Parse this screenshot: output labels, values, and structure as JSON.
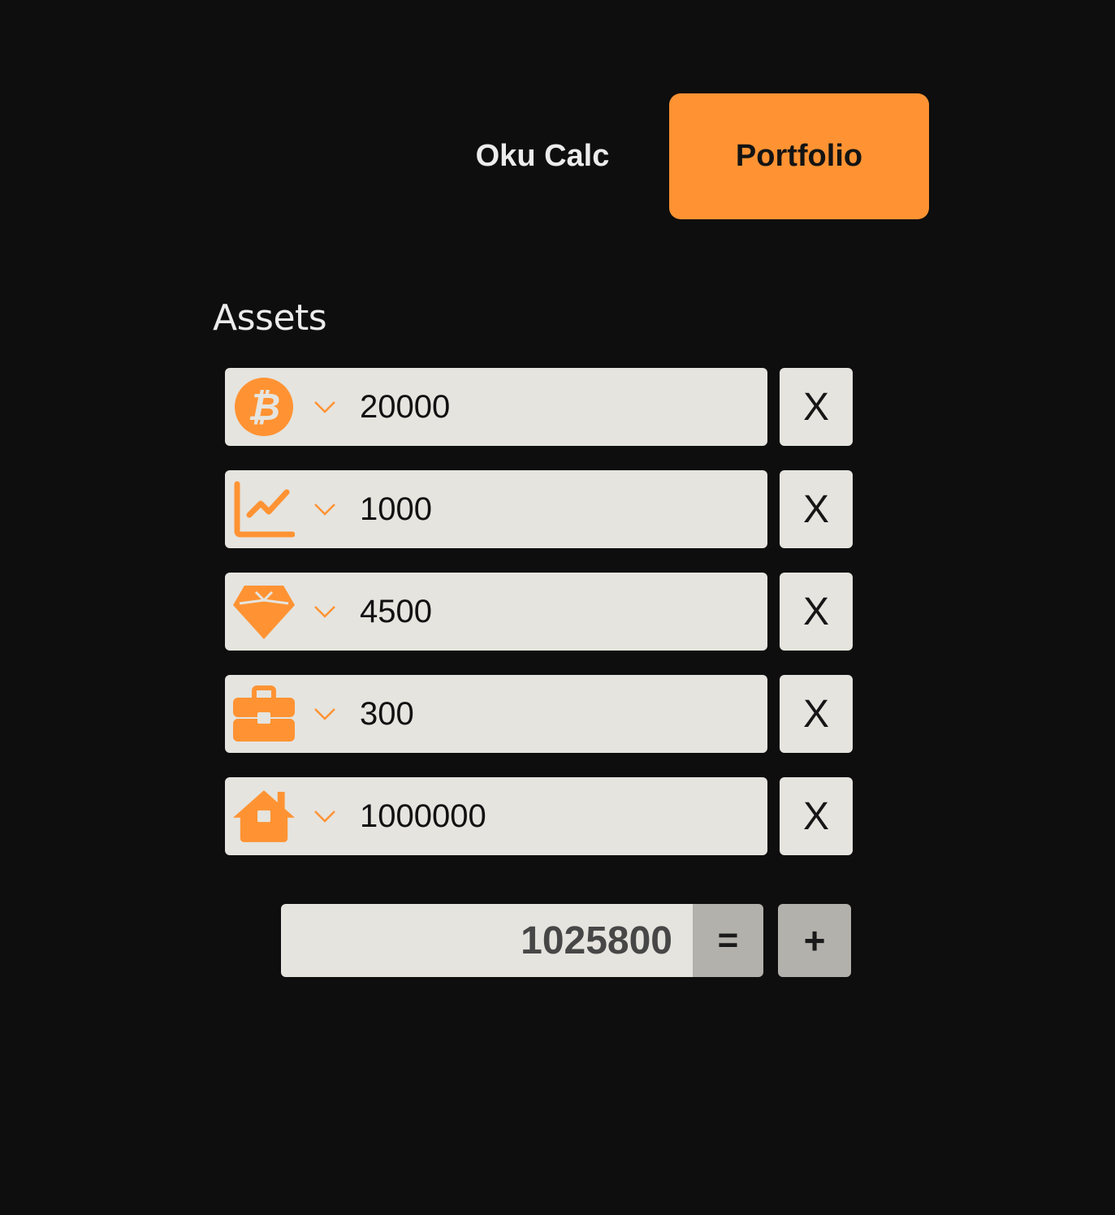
{
  "nav": {
    "calc_label": "Oku Calc",
    "portfolio_label": "Portfolio"
  },
  "section": {
    "title": "Assets"
  },
  "assets": [
    {
      "icon": "bitcoin-icon",
      "value": "20000"
    },
    {
      "icon": "stock-chart-icon",
      "value": "1000"
    },
    {
      "icon": "diamond-icon",
      "value": "4500"
    },
    {
      "icon": "briefcase-icon",
      "value": "300"
    },
    {
      "icon": "house-icon",
      "value": "1000000"
    }
  ],
  "remove_label": "X",
  "total": {
    "value": "1025800",
    "equals_label": "=",
    "add_label": "+"
  },
  "colors": {
    "background": "#0e0e0e",
    "accent": "#ff9333",
    "field": "#e5e4df",
    "button_gray": "#b2b1ab"
  }
}
